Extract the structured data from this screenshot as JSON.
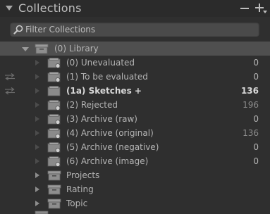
{
  "panel": {
    "title": "Collections",
    "filter_placeholder": "Filter Collections"
  },
  "library": {
    "label": "(0) Library"
  },
  "items": [
    {
      "label": "(0) Unevaluated",
      "count": "0"
    },
    {
      "label": "(1) To be evaluated",
      "count": "0"
    },
    {
      "label": "(1a) Sketches +",
      "count": "136"
    },
    {
      "label": "(2) Rejected",
      "count": "196"
    },
    {
      "label": "(3) Archive (raw)",
      "count": "0"
    },
    {
      "label": "(4) Archive (original)",
      "count": "136"
    },
    {
      "label": "(5) Archive (negative)",
      "count": "0"
    },
    {
      "label": "(6) Archive (image)",
      "count": "0"
    }
  ],
  "sets": [
    {
      "label": "Projects"
    },
    {
      "label": "Rating"
    },
    {
      "label": "Topic"
    }
  ],
  "colors": {
    "panel_bg": "#2f2f2f",
    "selected_row_bg": "#4f4f4f",
    "text": "#b4b4b4",
    "text_bold": "#d8d8d8"
  }
}
